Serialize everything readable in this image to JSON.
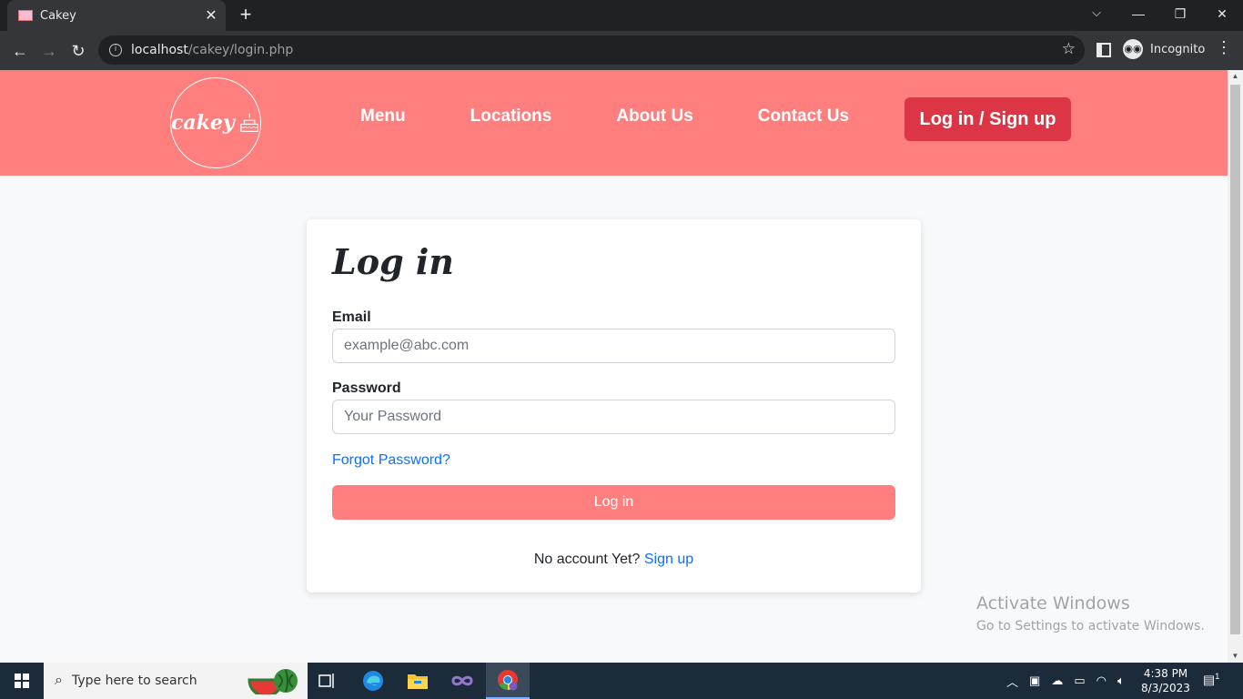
{
  "browser": {
    "tab_title": "Cakey",
    "url_host": "localhost",
    "url_path": "/cakey/login.php",
    "profile_label": "Incognito"
  },
  "site": {
    "logo_text": "cakey",
    "nav": [
      "Menu",
      "Locations",
      "About Us",
      "Contact Us"
    ],
    "auth_button": "Log in / Sign up"
  },
  "login_form": {
    "title": "Log in",
    "email_label": "Email",
    "email_placeholder": "example@abc.com",
    "password_label": "Password",
    "password_placeholder": "Your Password",
    "forgot_link": "Forgot Password?",
    "submit_label": "Log in",
    "no_account_text": "No account Yet?",
    "signup_link": "Sign up"
  },
  "watermark": {
    "title": "Activate Windows",
    "subtitle": "Go to Settings to activate Windows."
  },
  "taskbar": {
    "search_placeholder": "Type here to search",
    "time": "4:38 PM",
    "date": "8/3/2023",
    "notification_count": "1"
  },
  "colors": {
    "header_bg": "#ff7f7f",
    "auth_button_bg": "#dc3545",
    "link": "#0d6efd"
  }
}
